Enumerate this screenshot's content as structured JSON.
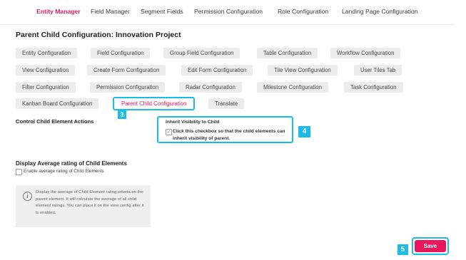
{
  "nav": {
    "tabs": [
      {
        "label": "Entity Manager",
        "active": true
      },
      {
        "label": "Field Manager"
      },
      {
        "label": "Segment Fields"
      },
      {
        "label": "Permission Configuration"
      },
      {
        "label": "Role Configuration"
      },
      {
        "label": "Landing Page Configuration"
      }
    ]
  },
  "page_title": "Parent Child Configuration: Innovation Project",
  "chips": [
    [
      "Entity Configuration",
      "Field Configuration",
      "Group Field Configuration",
      "Table Configuration",
      "Workflow Configuration"
    ],
    [
      "View Configuration",
      "Create Form Configuration",
      "Edit Form Configuration",
      "Tile View Configuration",
      "User Tiles Tab"
    ],
    [
      "Filter Configuration",
      "Permission Configuration",
      "Radar Configuration",
      "Milestone Configuration",
      "Task Configuration"
    ],
    [
      "Kanban Board Configuration",
      "Parent Child Configuration",
      "Translate"
    ]
  ],
  "active_chip": "Parent Child Configuration",
  "markers": {
    "m3": "3",
    "m4": "4",
    "m5": "5"
  },
  "control_section": {
    "label": "Control Child Element Actions",
    "inherit_title": "Inherit Visibility to Child",
    "checkbox_checked": true,
    "checkbox_text": "Click this checkbox so that the child elements can inherit visibility of parent."
  },
  "average_section": {
    "title": "Display Average rating of Child Elements",
    "checkbox_label": "Enable average rating of Child Elements",
    "checkbox_checked": false,
    "info_icon": "info-icon",
    "info_text": "Display the average of Child Element rating criteria on the parent element. It will calculate the average of all child element ratings. You can place it on the view config after it is enabled."
  },
  "save_label": "Save",
  "colors": {
    "accent": "#e8175d",
    "highlight": "#1bbcea",
    "chip_bg": "#ececec"
  }
}
